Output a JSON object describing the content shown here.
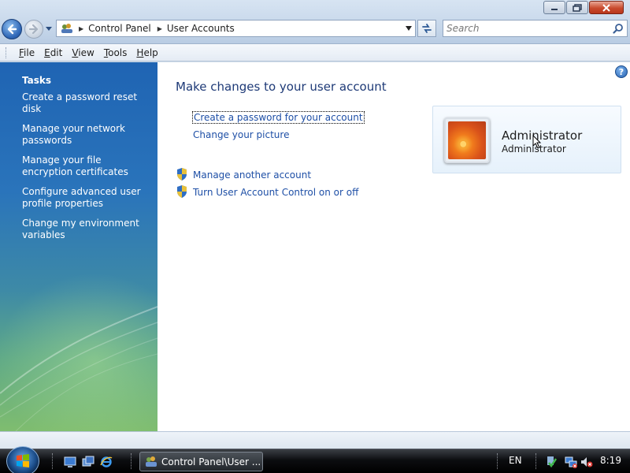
{
  "address_bar": {
    "crumbs": [
      "Control Panel",
      "User Accounts"
    ]
  },
  "search": {
    "placeholder": "Search"
  },
  "menu": {
    "items": [
      {
        "underline": "F",
        "rest": "ile"
      },
      {
        "underline": "E",
        "rest": "dit"
      },
      {
        "underline": "V",
        "rest": "iew"
      },
      {
        "underline": "T",
        "rest": "ools"
      },
      {
        "underline": "H",
        "rest": "elp"
      }
    ]
  },
  "sidebar": {
    "heading": "Tasks",
    "links": [
      "Create a password reset disk",
      "Manage your network passwords",
      "Manage your file encryption certificates",
      "Configure advanced user profile properties",
      "Change my environment variables"
    ]
  },
  "main": {
    "title": "Make changes to your user account",
    "links": {
      "create_password": "Create a password for your account",
      "change_picture": "Change your picture",
      "manage_account": "Manage another account",
      "uac": "Turn User Account Control on or off"
    },
    "help_label": "?",
    "account": {
      "name": "Administrator",
      "type": "Administrator"
    }
  },
  "taskbar": {
    "task_label": "Control Panel\\User ...",
    "language": "EN",
    "clock": "8:19"
  },
  "colors": {
    "link": "#1e4fa6",
    "title": "#1e3a77",
    "sidebar_top": "#1f64b3",
    "sidebar_bottom": "#7fbd6f"
  }
}
